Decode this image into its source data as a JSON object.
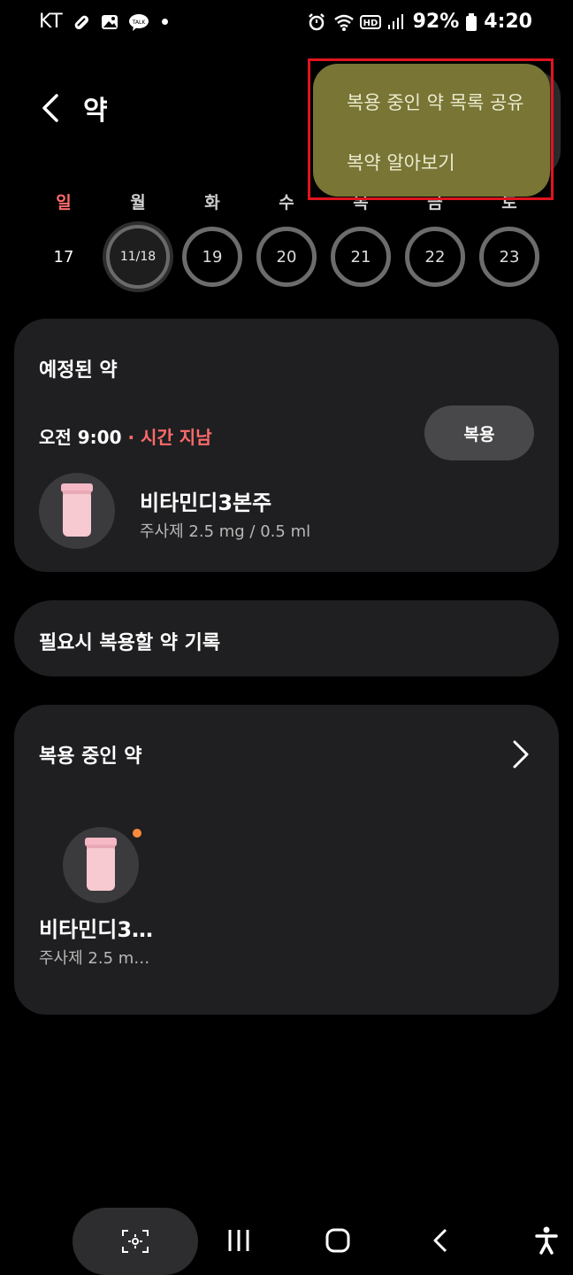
{
  "status_bar": {
    "carrier": "KT",
    "battery": "92%",
    "time": "4:20"
  },
  "header": {
    "title": "약"
  },
  "menu": {
    "items": [
      {
        "label": "복용 중인 약 목록 공유"
      },
      {
        "label": "복약 알아보기"
      }
    ]
  },
  "week": {
    "days": [
      {
        "label": "일",
        "date": "17",
        "state": "plain"
      },
      {
        "label": "월",
        "date": "11/18",
        "state": "selected"
      },
      {
        "label": "화",
        "date": "19",
        "state": "ring"
      },
      {
        "label": "수",
        "date": "20",
        "state": "ring"
      },
      {
        "label": "목",
        "date": "21",
        "state": "ring"
      },
      {
        "label": "금",
        "date": "22",
        "state": "ring"
      },
      {
        "label": "토",
        "date": "23",
        "state": "ring"
      }
    ]
  },
  "scheduled": {
    "title": "예정된 약",
    "time": "오전 9:00",
    "status": " · 시간 지남",
    "take_button": "복용",
    "med_name": "비타민디3본주",
    "med_desc": "주사제 2.5 mg / 0.5 ml"
  },
  "record": {
    "label": "필요시 복용할 약 기록"
  },
  "current": {
    "title": "복용 중인 약",
    "med_name": "비타민디3…",
    "med_desc": "주사제 2.5 m…"
  },
  "colors": {
    "menu_bg": "#787535",
    "card_bg": "#1f1f21",
    "late": "#ff6b6b",
    "highlight": "#e0141e",
    "dot": "#ff8a3c"
  },
  "icons": {
    "back": "chevron-left-icon",
    "more": "chevron-right-icon",
    "pill": "pill-bottle-icon"
  }
}
